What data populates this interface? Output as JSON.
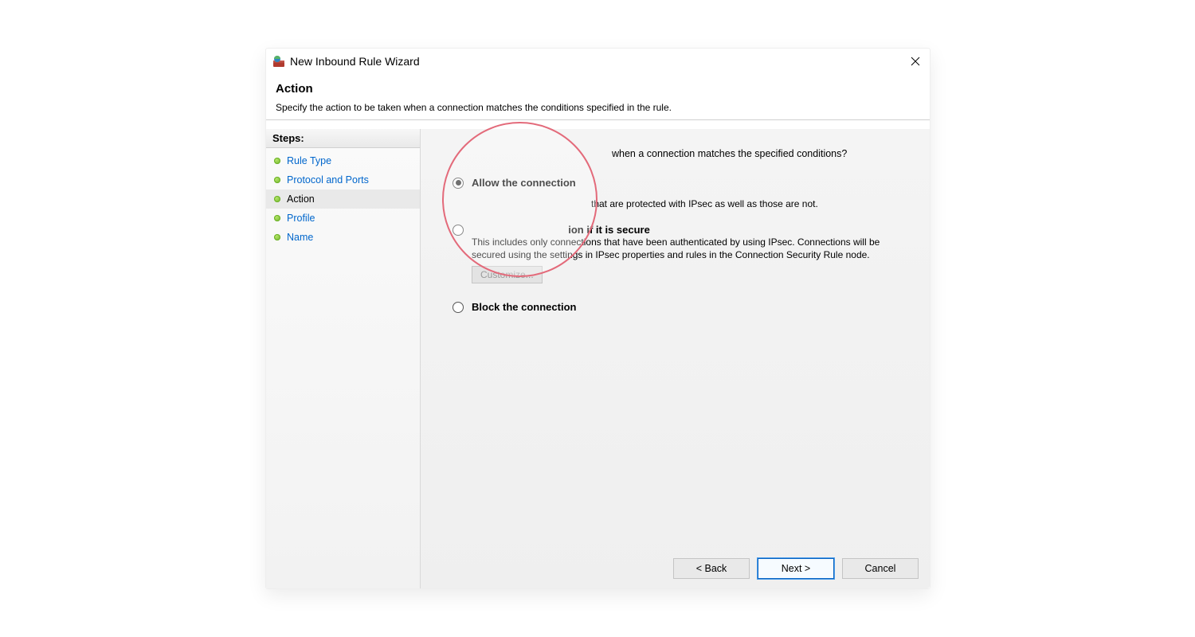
{
  "window": {
    "title": "New Inbound Rule Wizard"
  },
  "header": {
    "title": "Action",
    "subtitle": "Specify the action to be taken when a connection matches the conditions specified in the rule."
  },
  "steps": {
    "heading": "Steps:",
    "items": [
      {
        "label": "Rule Type",
        "current": false
      },
      {
        "label": "Protocol and Ports",
        "current": false
      },
      {
        "label": "Action",
        "current": true
      },
      {
        "label": "Profile",
        "current": false
      },
      {
        "label": "Name",
        "current": false
      }
    ]
  },
  "main": {
    "question_suffix": "when a connection matches the specified conditions?",
    "option1": {
      "label": "Allow the connection",
      "description_suffix": "that are protected with IPsec as well as those are not."
    },
    "option2": {
      "label_suffix": "ion if it is secure",
      "description": "This includes only connections that have been authenticated by using IPsec.  Connections will be secured using the settings in IPsec properties and rules in the Connection Security Rule node.",
      "customize_label": "Customize..."
    },
    "option3": {
      "label": "Block the connection"
    }
  },
  "buttons": {
    "back": "< Back",
    "next": "Next >",
    "cancel": "Cancel"
  }
}
